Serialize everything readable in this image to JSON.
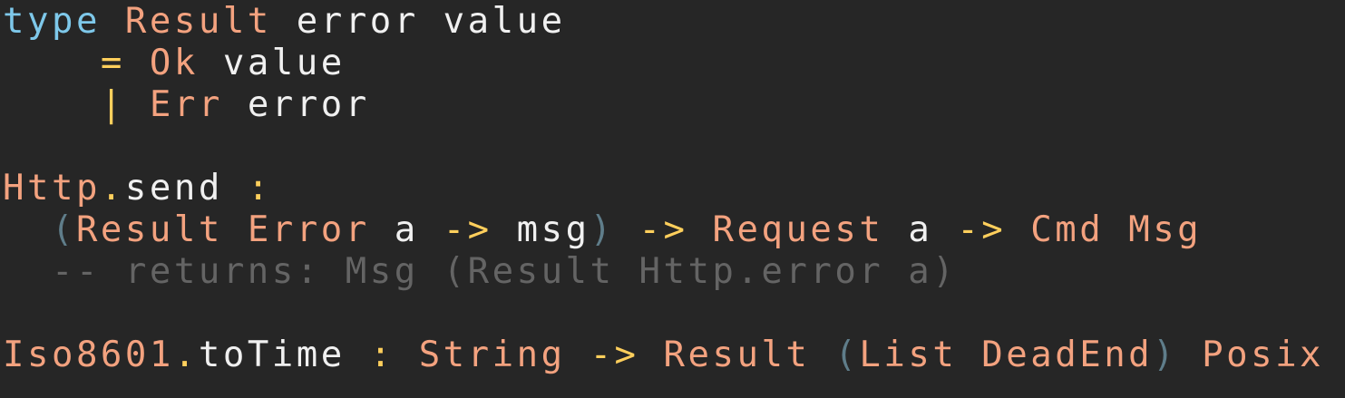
{
  "editor": {
    "background": "#262626",
    "colors": {
      "keyword": "#7ec8ea",
      "type": "#f3a27f",
      "plain": "#f0f0f0",
      "operator": "#ffcf5c",
      "paren": "#5f7d8a",
      "comment": "#646464"
    },
    "lines": [
      [
        {
          "t": "type",
          "c": "keyword"
        },
        {
          "t": " ",
          "c": "plain"
        },
        {
          "t": "Result",
          "c": "type"
        },
        {
          "t": " error value",
          "c": "plain"
        }
      ],
      [
        {
          "t": "    ",
          "c": "plain"
        },
        {
          "t": "=",
          "c": "operator"
        },
        {
          "t": " ",
          "c": "plain"
        },
        {
          "t": "Ok",
          "c": "type"
        },
        {
          "t": " value",
          "c": "plain"
        }
      ],
      [
        {
          "t": "    ",
          "c": "plain"
        },
        {
          "t": "|",
          "c": "operator"
        },
        {
          "t": " ",
          "c": "plain"
        },
        {
          "t": "Err",
          "c": "type"
        },
        {
          "t": " error",
          "c": "plain"
        }
      ],
      [],
      [
        {
          "t": "Http",
          "c": "type"
        },
        {
          "t": ".",
          "c": "operator"
        },
        {
          "t": "send ",
          "c": "plain"
        },
        {
          "t": ":",
          "c": "operator"
        }
      ],
      [
        {
          "t": "  ",
          "c": "plain"
        },
        {
          "t": "(",
          "c": "paren"
        },
        {
          "t": "Result",
          "c": "type"
        },
        {
          "t": " ",
          "c": "plain"
        },
        {
          "t": "Error",
          "c": "type"
        },
        {
          "t": " a ",
          "c": "plain"
        },
        {
          "t": "->",
          "c": "operator"
        },
        {
          "t": " msg",
          "c": "plain"
        },
        {
          "t": ")",
          "c": "paren"
        },
        {
          "t": " ",
          "c": "plain"
        },
        {
          "t": "->",
          "c": "operator"
        },
        {
          "t": " ",
          "c": "plain"
        },
        {
          "t": "Request",
          "c": "type"
        },
        {
          "t": " a ",
          "c": "plain"
        },
        {
          "t": "->",
          "c": "operator"
        },
        {
          "t": " ",
          "c": "plain"
        },
        {
          "t": "Cmd",
          "c": "type"
        },
        {
          "t": " ",
          "c": "plain"
        },
        {
          "t": "Msg",
          "c": "type"
        }
      ],
      [
        {
          "t": "  ",
          "c": "plain"
        },
        {
          "t": "-- returns: Msg (Result Http.error a)",
          "c": "comment"
        }
      ],
      [],
      [
        {
          "t": "Iso8601",
          "c": "type"
        },
        {
          "t": ".",
          "c": "operator"
        },
        {
          "t": "toTime ",
          "c": "plain"
        },
        {
          "t": ":",
          "c": "operator"
        },
        {
          "t": " ",
          "c": "plain"
        },
        {
          "t": "String",
          "c": "type"
        },
        {
          "t": " ",
          "c": "plain"
        },
        {
          "t": "->",
          "c": "operator"
        },
        {
          "t": " ",
          "c": "plain"
        },
        {
          "t": "Result",
          "c": "type"
        },
        {
          "t": " ",
          "c": "plain"
        },
        {
          "t": "(",
          "c": "paren"
        },
        {
          "t": "List",
          "c": "type"
        },
        {
          "t": " ",
          "c": "plain"
        },
        {
          "t": "DeadEnd",
          "c": "type"
        },
        {
          "t": ")",
          "c": "paren"
        },
        {
          "t": " ",
          "c": "plain"
        },
        {
          "t": "Posix",
          "c": "type"
        }
      ]
    ]
  }
}
